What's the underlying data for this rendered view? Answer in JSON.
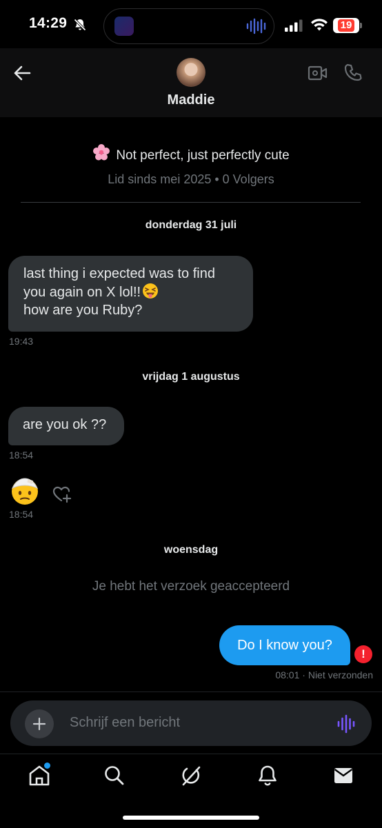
{
  "status_bar": {
    "time": "14:29",
    "battery": "19",
    "icons": [
      "bell-slash-icon",
      "signal-icon",
      "wifi-icon",
      "battery-icon"
    ]
  },
  "header": {
    "name": "Maddie",
    "icons": [
      "back-arrow-icon",
      "video-call-icon",
      "phone-call-icon"
    ]
  },
  "profile": {
    "bio_emoji": "cherry-blossom",
    "bio": "Not perfect, just perfectly cute",
    "meta": "Lid sinds mei 2025 • 0 Volgers"
  },
  "conversation": {
    "date1": "donderdag 31 juli",
    "msg1_lines": [
      "last thing i expected was to find",
      "you again on X lol!!",
      "how are you  Ruby?"
    ],
    "msg1_time": "19:43",
    "date2": "vrijdag 1 augustus",
    "msg2": "are you ok ??",
    "msg2_time": "18:54",
    "reaction_emoji": "face-with-head-bandage",
    "reaction_time": "18:54",
    "date3": "woensdag",
    "system_msg": "Je hebt het verzoek geaccepteerd",
    "out_msg": "Do I know you?",
    "out_time": "08:01",
    "out_status": " · Niet verzonden",
    "error_mark": "!"
  },
  "composer": {
    "placeholder": "Schrijf een bericht"
  },
  "colors": {
    "accent": "#1d9bf0",
    "bubble_in": "#2f3336",
    "error": "#f4212e",
    "voice": "#7856ff"
  },
  "tabs": [
    "home-icon",
    "search-icon",
    "grok-icon",
    "notifications-icon",
    "messages-icon"
  ]
}
